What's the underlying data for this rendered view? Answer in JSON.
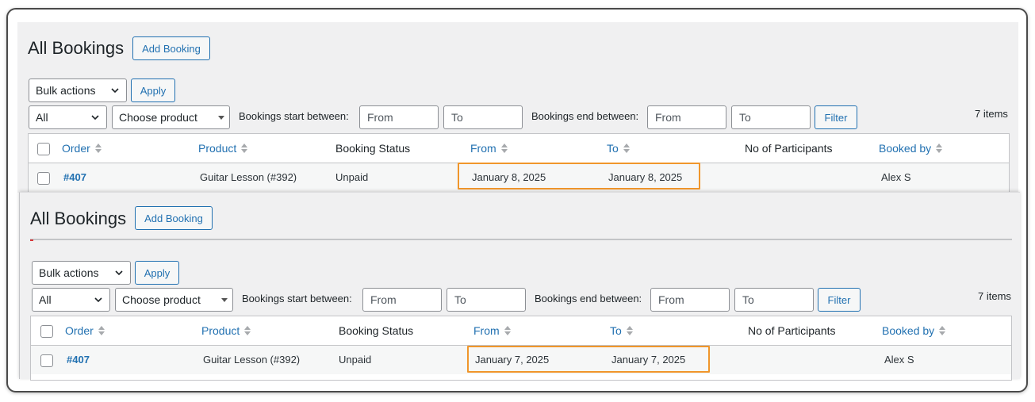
{
  "colors": {
    "link": "#2271b1",
    "highlight": "#f0962b",
    "panel_bg": "#f0f0f1"
  },
  "screens": [
    {
      "title": "All Bookings",
      "add_button": "Add Booking",
      "bulk_actions": "Bulk actions",
      "apply": "Apply",
      "status_filter": "All",
      "product_filter": "Choose product",
      "start_label": "Bookings start between:",
      "end_label": "Bookings end between:",
      "from_placeholder": "From",
      "to_placeholder": "To",
      "filter": "Filter",
      "items_count": "7 items",
      "columns": {
        "order": "Order",
        "product": "Product",
        "status": "Booking Status",
        "from": "From",
        "to": "To",
        "participants": "No of Participants",
        "booked_by": "Booked by"
      },
      "row": {
        "order": "#407",
        "product": "Guitar Lesson (#392)",
        "status": "Unpaid",
        "from": "January 8, 2025",
        "to": "January 8, 2025",
        "participants": "",
        "booked_by": "Alex S"
      }
    },
    {
      "title": "All Bookings",
      "add_button": "Add Booking",
      "bulk_actions": "Bulk actions",
      "apply": "Apply",
      "status_filter": "All",
      "product_filter": "Choose product",
      "start_label": "Bookings start between:",
      "end_label": "Bookings end between:",
      "from_placeholder": "From",
      "to_placeholder": "To",
      "filter": "Filter",
      "items_count": "7 items",
      "columns": {
        "order": "Order",
        "product": "Product",
        "status": "Booking Status",
        "from": "From",
        "to": "To",
        "participants": "No of Participants",
        "booked_by": "Booked by"
      },
      "row": {
        "order": "#407",
        "product": "Guitar Lesson (#392)",
        "status": "Unpaid",
        "from": "January 7, 2025",
        "to": "January 7, 2025",
        "participants": "",
        "booked_by": "Alex S"
      }
    }
  ]
}
